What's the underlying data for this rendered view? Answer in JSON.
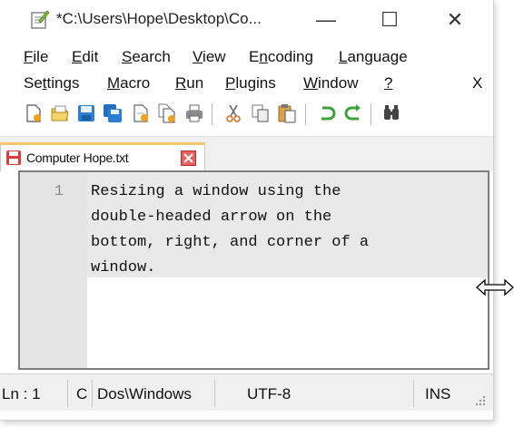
{
  "window": {
    "title": "*C:\\Users\\Hope\\Desktop\\Co...",
    "minimize_glyph": "—",
    "maximize_glyph": "☐",
    "close_glyph": "✕"
  },
  "menubar": {
    "row1": [
      {
        "label": "File",
        "underline": "F",
        "rest": "ile"
      },
      {
        "label": "Edit",
        "underline": "E",
        "rest": "dit"
      },
      {
        "label": "Search",
        "underline": "S",
        "rest": "earch"
      },
      {
        "label": "View",
        "underline": "V",
        "rest": "iew"
      },
      {
        "label": "Encoding",
        "pre": "E",
        "underline": "n",
        "rest": "coding"
      },
      {
        "label": "Language",
        "underline": "L",
        "rest": "anguage"
      }
    ],
    "row2": [
      {
        "label": "Settings",
        "pre": "Se",
        "underline": "t",
        "rest": "tings"
      },
      {
        "label": "Macro",
        "underline": "M",
        "rest": "acro"
      },
      {
        "label": "Run",
        "underline": "R",
        "rest": "un"
      },
      {
        "label": "Plugins",
        "underline": "P",
        "rest": "lugins"
      },
      {
        "label": "Window",
        "underline": "W",
        "rest": "indow"
      },
      {
        "label": "?",
        "underline": "?",
        "rest": ""
      }
    ],
    "close_doc": "X"
  },
  "toolbar": {
    "icons": [
      "new-file-icon",
      "open-file-icon",
      "save-icon",
      "save-all-icon",
      "close-icon",
      "close-all-icon",
      "print-icon",
      "cut-icon",
      "copy-icon",
      "paste-icon",
      "undo-icon",
      "redo-icon",
      "find-icon"
    ],
    "accent": "#2a7fd4"
  },
  "tab": {
    "label": "Computer Hope.txt",
    "accent": "#f6c66c"
  },
  "editor": {
    "line_number": "1",
    "lines": [
      "Resizing a window using the",
      "double-headed arrow on the",
      "bottom, right, and corner of a",
      "window."
    ]
  },
  "statusbar": {
    "position": "Ln : 1",
    "col": "C",
    "eol": "Dos\\Windows",
    "encoding": "UTF-8",
    "mode": "INS"
  }
}
